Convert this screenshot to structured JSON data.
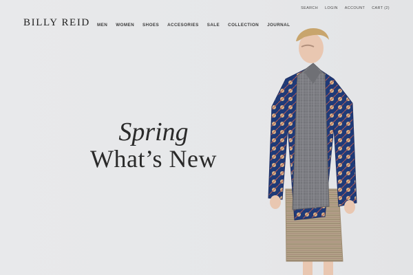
{
  "brand": {
    "logo": "BILLY REID"
  },
  "main_nav": [
    "MEN",
    "WOMEN",
    "SHOES",
    "ACCESORIES",
    "SALE",
    "COLLECTION",
    "JOURNAL"
  ],
  "utility_nav": [
    "SEARCH",
    "LOGIN",
    "ACCOUNT",
    "CART (2)"
  ],
  "hero": {
    "season": "Spring",
    "title": "What’s New"
  },
  "colors": {
    "background": "#e7e8ea",
    "text": "#2a2a2a",
    "cardigan": "#1f3a78"
  },
  "image": {
    "name": "model-photo"
  }
}
